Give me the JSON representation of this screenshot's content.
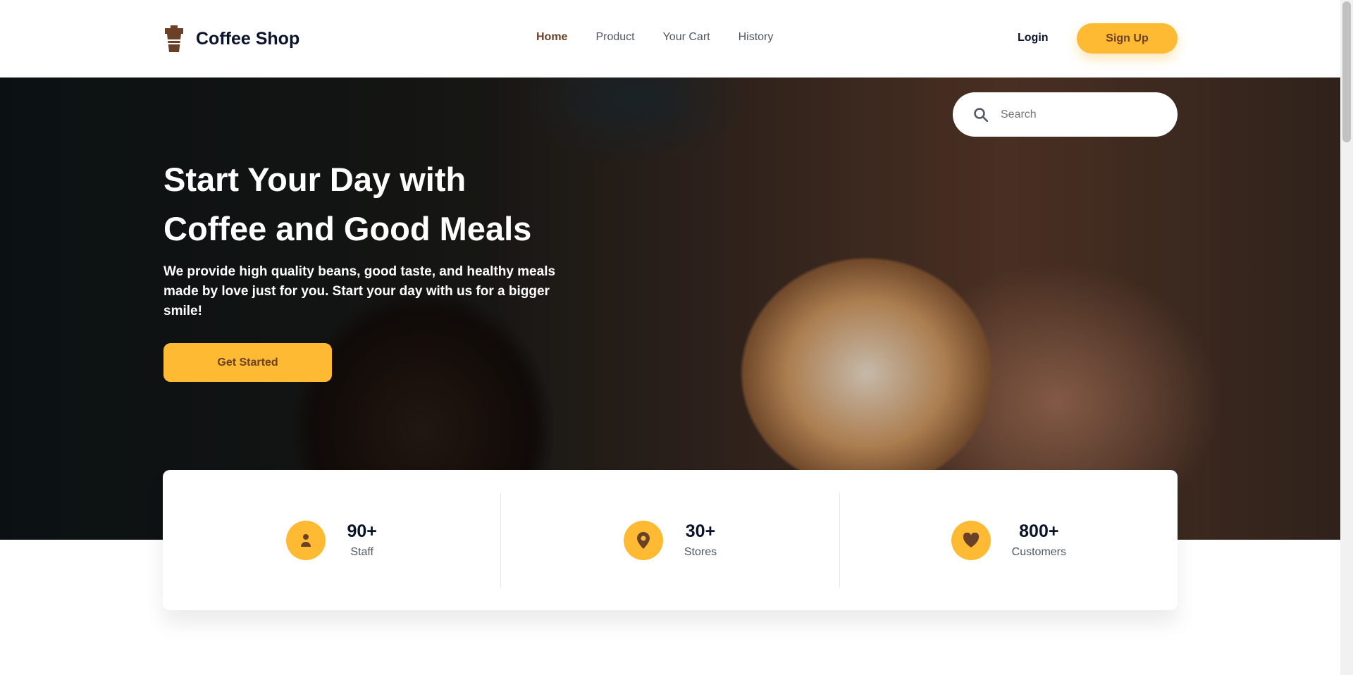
{
  "brand": {
    "name": "Coffee Shop",
    "icon": "coffee-cup-icon"
  },
  "nav": {
    "links": [
      {
        "label": "Home",
        "active": true
      },
      {
        "label": "Product"
      },
      {
        "label": "Your Cart"
      },
      {
        "label": "History"
      }
    ],
    "login": "Login",
    "signup": "Sign Up"
  },
  "search": {
    "placeholder": "Search",
    "value": ""
  },
  "hero": {
    "title_line1": "Start Your Day with",
    "title_line2": "Coffee and Good Meals",
    "description": "We provide high quality beans, good taste, and healthy meals made by love just for you. Start your day with us for a bigger smile!",
    "cta": "Get Started"
  },
  "stats": [
    {
      "value": "90+",
      "label": "Staff",
      "icon": "user-icon"
    },
    {
      "value": "30+",
      "label": "Stores",
      "icon": "location-pin-icon"
    },
    {
      "value": "800+",
      "label": "Customers",
      "icon": "heart-icon"
    }
  ],
  "colors": {
    "accent": "#ffba33",
    "brown": "#6a4029",
    "text": "#0b132a"
  }
}
